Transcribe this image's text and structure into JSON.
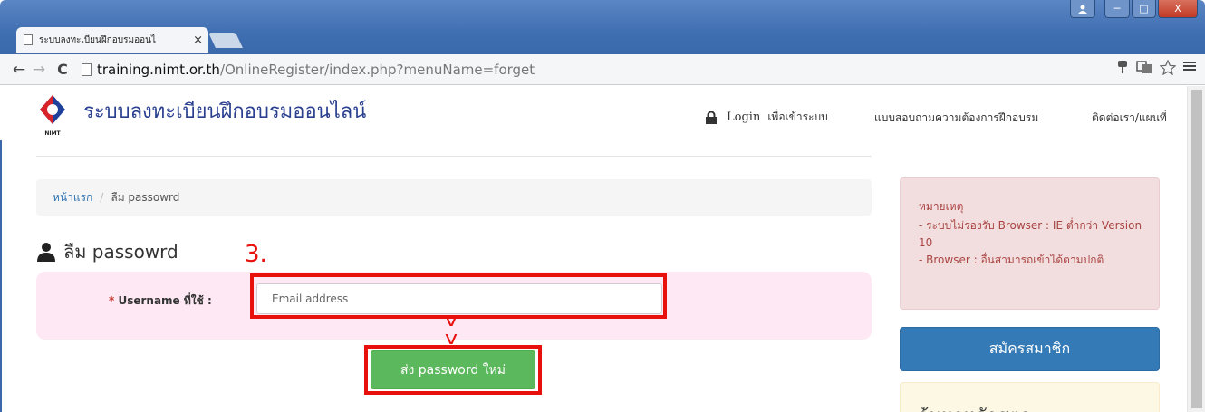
{
  "browser": {
    "tab_title": "ระบบลงทะเบียนฝึกอบรมออนไ",
    "tab_close": "×",
    "url_host": "training.nimt.or.th",
    "url_path": "/OnlineRegister/index.php?menuName=forget",
    "back_glyph": "←",
    "forward_glyph": "→",
    "reload_glyph": "C",
    "win_min": "─",
    "win_max": "□",
    "win_close": "X"
  },
  "header": {
    "site_title": "ระบบลงทะเบียนฝึกอบรมออนไลน์",
    "login_label": "Login",
    "login_sub": "เพื่อเข้าระบบ",
    "survey_link": "แบบสอบถามความต้องการฝึกอบรม",
    "contact_link": "ติดต่อเรา/แผนที่"
  },
  "breadcrumb": {
    "home": "หน้าแรก",
    "separator": "/",
    "current": "ลืม passowrd"
  },
  "page": {
    "heading": "ลืม passowrd",
    "step_annotation": "3."
  },
  "form": {
    "required_mark": "*",
    "username_label": "Username ที่ใช้ :",
    "email_placeholder": "Email address",
    "submit_label": "ส่ง password ใหม่",
    "arrow_glyph": "v"
  },
  "sidebar": {
    "note_title": "หมายเหตุ",
    "note_line_1": "- ระบบไม่รองรับ Browser : IE ต่ำกว่า Version 10",
    "note_line_2": "- Browser : อื่นสามารถเข้าได้ตามปกติ",
    "register_label": "สมัครสมาชิก",
    "search_title": "ค้นหาหลักสูตร"
  },
  "colors": {
    "annotation_red": "#e8100c",
    "brand_blue": "#2a3f8f",
    "success_green": "#5cb85c",
    "primary_blue": "#337ab7"
  }
}
